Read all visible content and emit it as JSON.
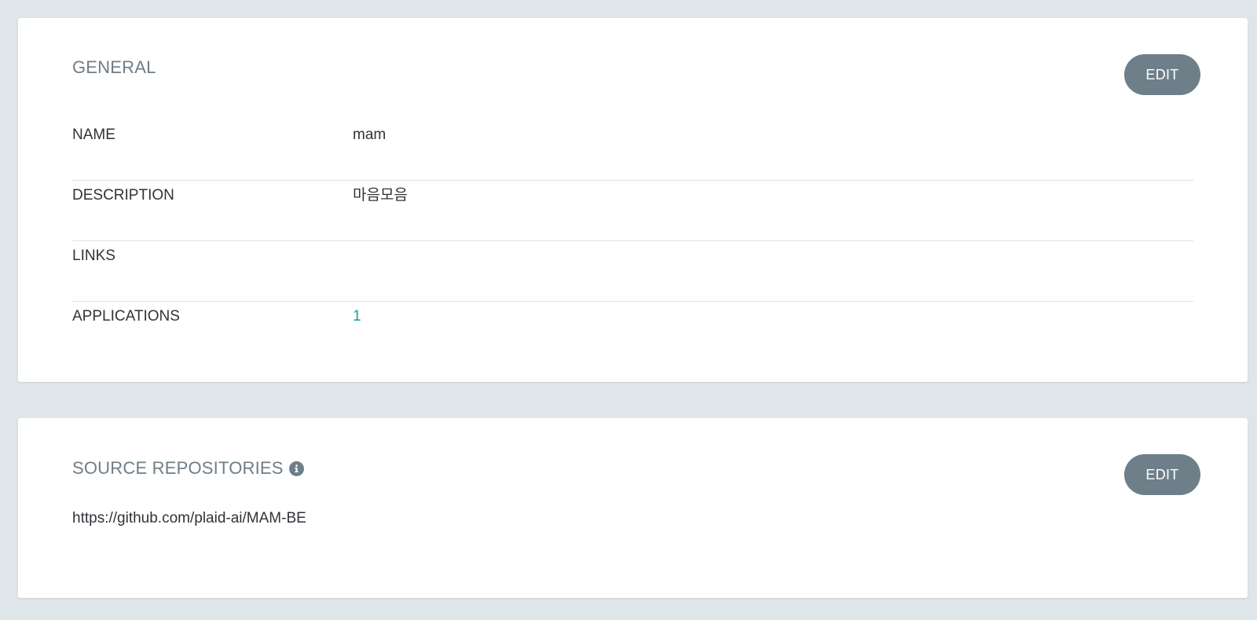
{
  "general": {
    "title": "GENERAL",
    "edit_label": "EDIT",
    "rows": [
      {
        "label": "NAME",
        "value": "mam"
      },
      {
        "label": "DESCRIPTION",
        "value": "마음모음"
      },
      {
        "label": "LINKS",
        "value": ""
      },
      {
        "label": "APPLICATIONS",
        "value": "1"
      }
    ]
  },
  "source_repositories": {
    "title": "SOURCE REPOSITORIES",
    "edit_label": "EDIT",
    "info_icon": "info-icon",
    "url": "https://github.com/plaid-ai/MAM-BE"
  },
  "colors": {
    "background": "#dfe6e9",
    "button": "#6e7f89",
    "link": "#1b98a8",
    "title": "#6f7d87"
  }
}
